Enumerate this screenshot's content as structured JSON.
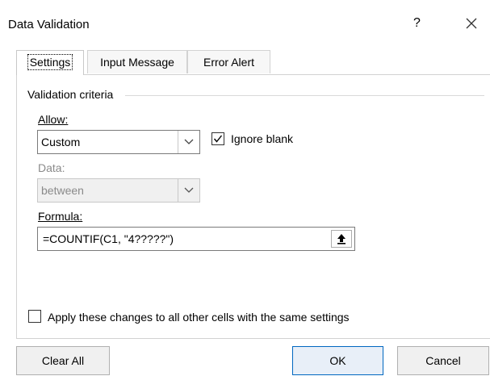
{
  "window": {
    "title": "Data Validation",
    "help_label": "?",
    "close_icon": "close-icon"
  },
  "tabs": [
    {
      "label": "Settings",
      "active": true
    },
    {
      "label": "Input Message",
      "active": false
    },
    {
      "label": "Error Alert",
      "active": false
    }
  ],
  "criteria": {
    "group_label": "Validation criteria",
    "allow_label": "Allow:",
    "allow_value": "Custom",
    "ignore_blank_label": "Ignore blank",
    "ignore_blank_checked": true,
    "data_label": "Data:",
    "data_value": "between",
    "formula_label": "Formula:",
    "formula_value": "=COUNTIF(C1, \"4?????\")"
  },
  "apply_all": {
    "label": "Apply these changes to all other cells with the same settings",
    "checked": false
  },
  "buttons": {
    "clear_all": "Clear All",
    "ok": "OK",
    "cancel": "Cancel"
  },
  "colors": {
    "ok_border": "#0067c0",
    "panel_border": "#d2d2d2"
  }
}
